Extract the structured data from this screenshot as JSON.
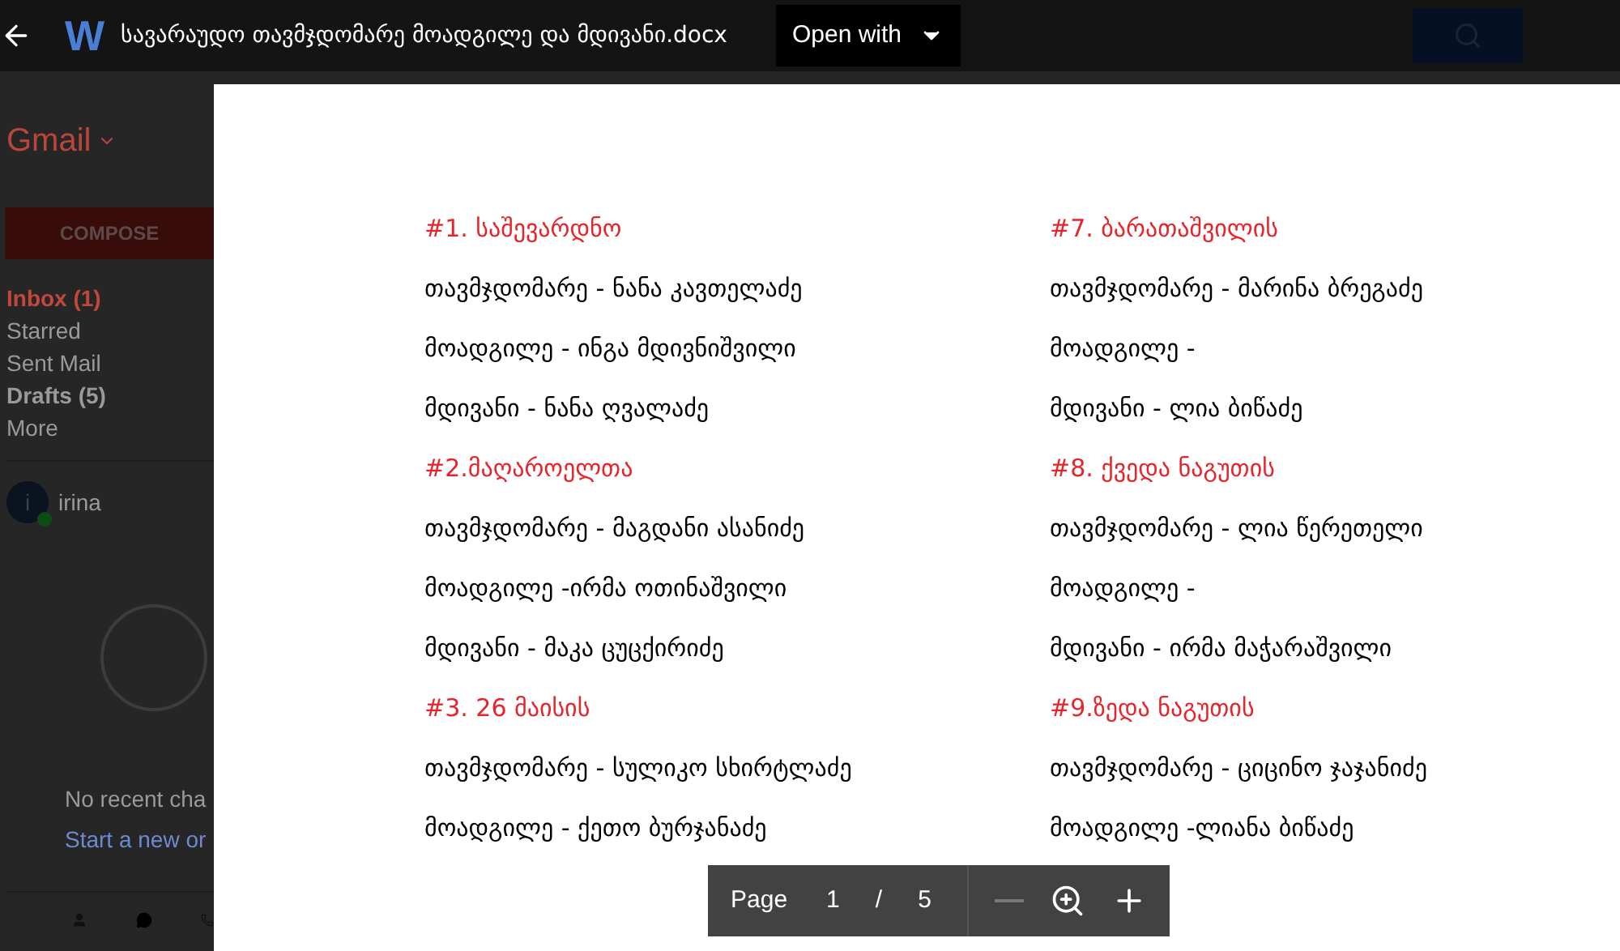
{
  "top_bar": {
    "app_letter": "W",
    "title": "სავარაუდო თავმჯდომარე მოადგილე და მდივანი.docx",
    "open_with": "Open with"
  },
  "gmail": {
    "logo": "Gmail",
    "compose": "COMPOSE",
    "folders": [
      {
        "label": "Inbox (1)",
        "selected": true,
        "bold": true
      },
      {
        "label": "Starred",
        "selected": false,
        "bold": false
      },
      {
        "label": "Sent Mail",
        "selected": false,
        "bold": false
      },
      {
        "label": "Drafts (5)",
        "selected": false,
        "bold": true
      },
      {
        "label": "More",
        "selected": false,
        "bold": false
      }
    ],
    "account": {
      "initial": "i",
      "name": "irina",
      "online": true
    },
    "chat": {
      "empty_text": "No recent cha",
      "start_link": "Start a new or"
    }
  },
  "document": {
    "columns": [
      [
        {
          "heading": "#1. საშევარდნო",
          "lines": [
            "თავმჯდომარე - ნანა კავთელაძე",
            "მოადგილე - ინგა მდივნიშვილი",
            "მდივანი - ნანა ღვალაძე"
          ]
        },
        {
          "heading": "#2.მაღაროელთა",
          "lines": [
            "თავმჯდომარე - მაგდანი ასანიძე",
            "მოადგილე -ირმა ოთინაშვილი",
            "მდივანი - მაკა ცუცქირიძე"
          ]
        },
        {
          "heading": "#3. 26 მაისის",
          "lines": [
            "თავმჯდომარე - სულიკო სხირტლაძე",
            "მოადგილე - ქეთო ბურჯანაძე"
          ]
        }
      ],
      [
        {
          "heading": "#7. ბარათაშვილის",
          "lines": [
            "თავმჯდომარე - მარინა ბრეგაძე",
            "მოადგილე -",
            "მდივანი - ლია ბიწაძე"
          ]
        },
        {
          "heading": "#8. ქვედა ნაგუთის",
          "lines": [
            "თავმჯდომარე - ლია წერეთელი",
            "მოადგილე -",
            "მდივანი - ირმა მაჭარაშვილი"
          ]
        },
        {
          "heading": "#9.ზედა ნაგუთის",
          "lines": [
            "თავმჯდომარე - ციცინო ჯაჯანიძე",
            "მოადგილე -ლიანა ბიწაძე"
          ]
        }
      ]
    ]
  },
  "pager": {
    "label": "Page",
    "current": "1",
    "separator": "/",
    "total": "5"
  }
}
